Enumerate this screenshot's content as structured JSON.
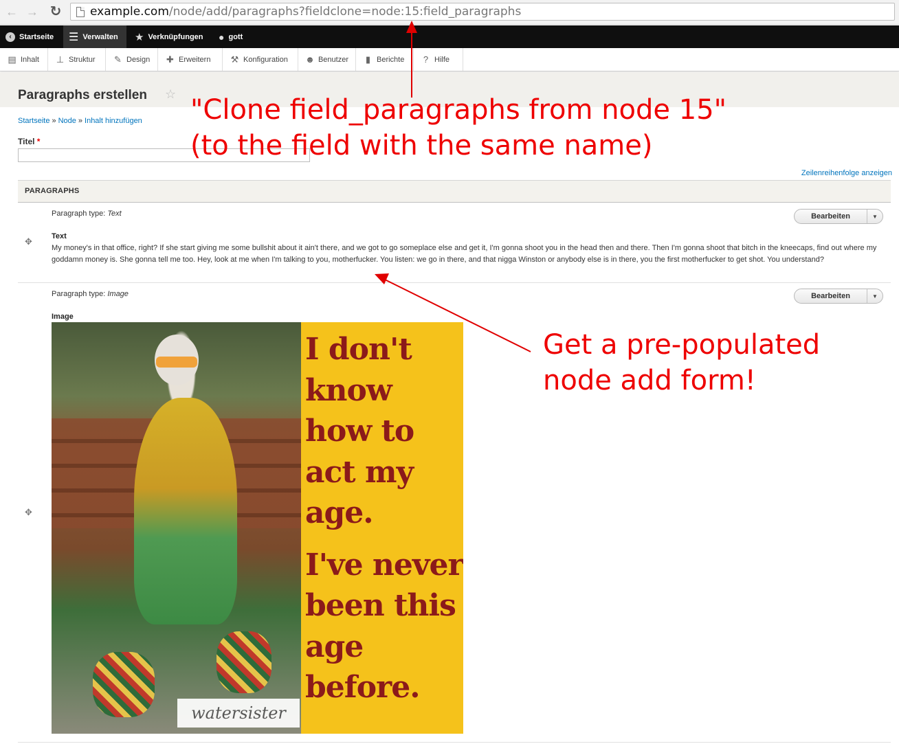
{
  "browser": {
    "url_host": "example.com",
    "url_path": "/node/add/paragraphs?fieldclone=node:15:field_paragraphs"
  },
  "toolbar": {
    "home": "Startseite",
    "manage": "Verwalten",
    "shortcuts": "Verknüpfungen",
    "user": "gott"
  },
  "tray": {
    "items": [
      {
        "label": "Inhalt",
        "icon": "document-icon"
      },
      {
        "label": "Struktur",
        "icon": "sitemap-icon"
      },
      {
        "label": "Design",
        "icon": "brush-icon"
      },
      {
        "label": "Erweitern",
        "icon": "puzzle-icon"
      },
      {
        "label": "Konfiguration",
        "icon": "wrench-icon"
      },
      {
        "label": "Benutzer",
        "icon": "people-icon"
      },
      {
        "label": "Berichte",
        "icon": "bar-chart-icon"
      },
      {
        "label": "Hilfe",
        "icon": "help-icon"
      }
    ]
  },
  "page": {
    "title": "Paragraphs erstellen",
    "breadcrumb": [
      "Startseite",
      "Node",
      "Inhalt hinzufügen"
    ],
    "breadcrumb_sep": "»",
    "title_label": "Titel",
    "title_value": "",
    "row_weight_link": "Zeilenreihenfolge anzeigen"
  },
  "paragraphs": {
    "header": "PARAGRAPHS",
    "type_prefix": "Paragraph type:",
    "edit_label": "Bearbeiten",
    "items": [
      {
        "type": "Text",
        "field_label": "Text",
        "body": "My money's in that office, right? If she start giving me some bullshit about it ain't there, and we got to go someplace else and get it, I'm gonna shoot you in the head then and there. Then I'm gonna shoot that bitch in the kneecaps, find out where my goddamn money is. She gonna tell me too. Hey, look at me when I'm talking to you, motherfucker. You listen: we go in there, and that nigga Winston or anybody else is in there, you the first motherfucker to get shot. You understand?"
      },
      {
        "type": "Image",
        "field_label": "Image",
        "image_text": [
          "I don't",
          "know",
          "how to",
          "act my",
          "age.",
          "I've never",
          "been this",
          "age",
          "before."
        ],
        "image_logo": "watersister"
      }
    ]
  },
  "annotations": {
    "clone_line1": "\"Clone field_paragraphs from node 15\"",
    "clone_line2": "(to the field with the same name)",
    "get_line1": "Get a pre-populated",
    "get_line2": "node add form!"
  },
  "colors": {
    "annotation": "#e00000",
    "toolbar_bg": "#0f0f0f",
    "link": "#0074bd"
  }
}
